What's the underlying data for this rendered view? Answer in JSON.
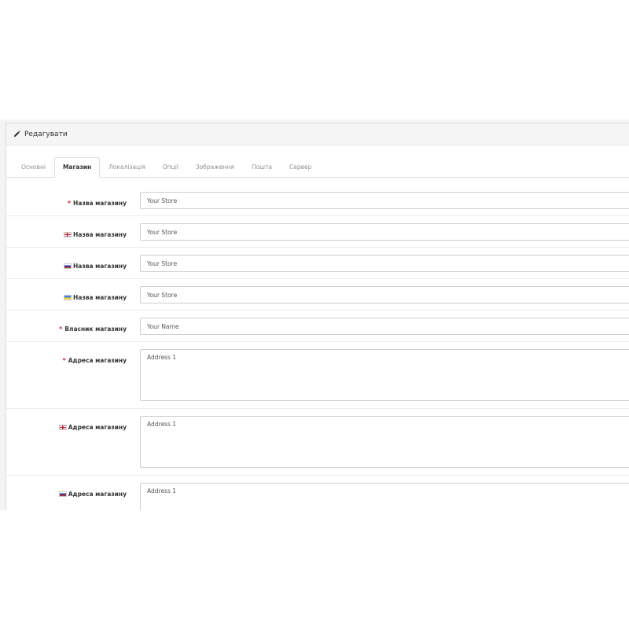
{
  "panel": {
    "title": "Редагувати",
    "icon": "pencil-icon"
  },
  "tabs": [
    {
      "label": "Основні",
      "active": false
    },
    {
      "label": "Магазин",
      "active": true
    },
    {
      "label": "Локалізація",
      "active": false
    },
    {
      "label": "Опції",
      "active": false
    },
    {
      "label": "Зображення",
      "active": false
    },
    {
      "label": "Пошта",
      "active": false
    },
    {
      "label": "Сервер",
      "active": false
    }
  ],
  "fields": {
    "store_name": {
      "required_mark": "*",
      "label": "Назва магазину",
      "value": "Your Store"
    },
    "store_name_en": {
      "flag": "gb-flag-icon",
      "label": "Назва магазину",
      "value": "Your Store"
    },
    "store_name_ru": {
      "flag": "ru-flag-icon",
      "label": "Назва магазину",
      "value": "Your Store"
    },
    "store_name_ua": {
      "flag": "ua-flag-icon",
      "label": "Назва магазину",
      "value": "Your Store"
    },
    "owner": {
      "required_mark": "*",
      "label": "Власник магазину",
      "value": "Your Name"
    },
    "address": {
      "required_mark": "*",
      "label": "Адреса магазину",
      "value": "Address 1"
    },
    "address_en": {
      "flag": "gb-flag-icon",
      "label": "Адреса магазину",
      "value": "Address 1"
    },
    "address_ru": {
      "flag": "ru-flag-icon",
      "label": "Адреса магазину",
      "value": "Address 1"
    }
  },
  "colors": {
    "required": "#e3242b",
    "active_tab_text": "#333333",
    "tab_text": "#8f8f8f"
  }
}
